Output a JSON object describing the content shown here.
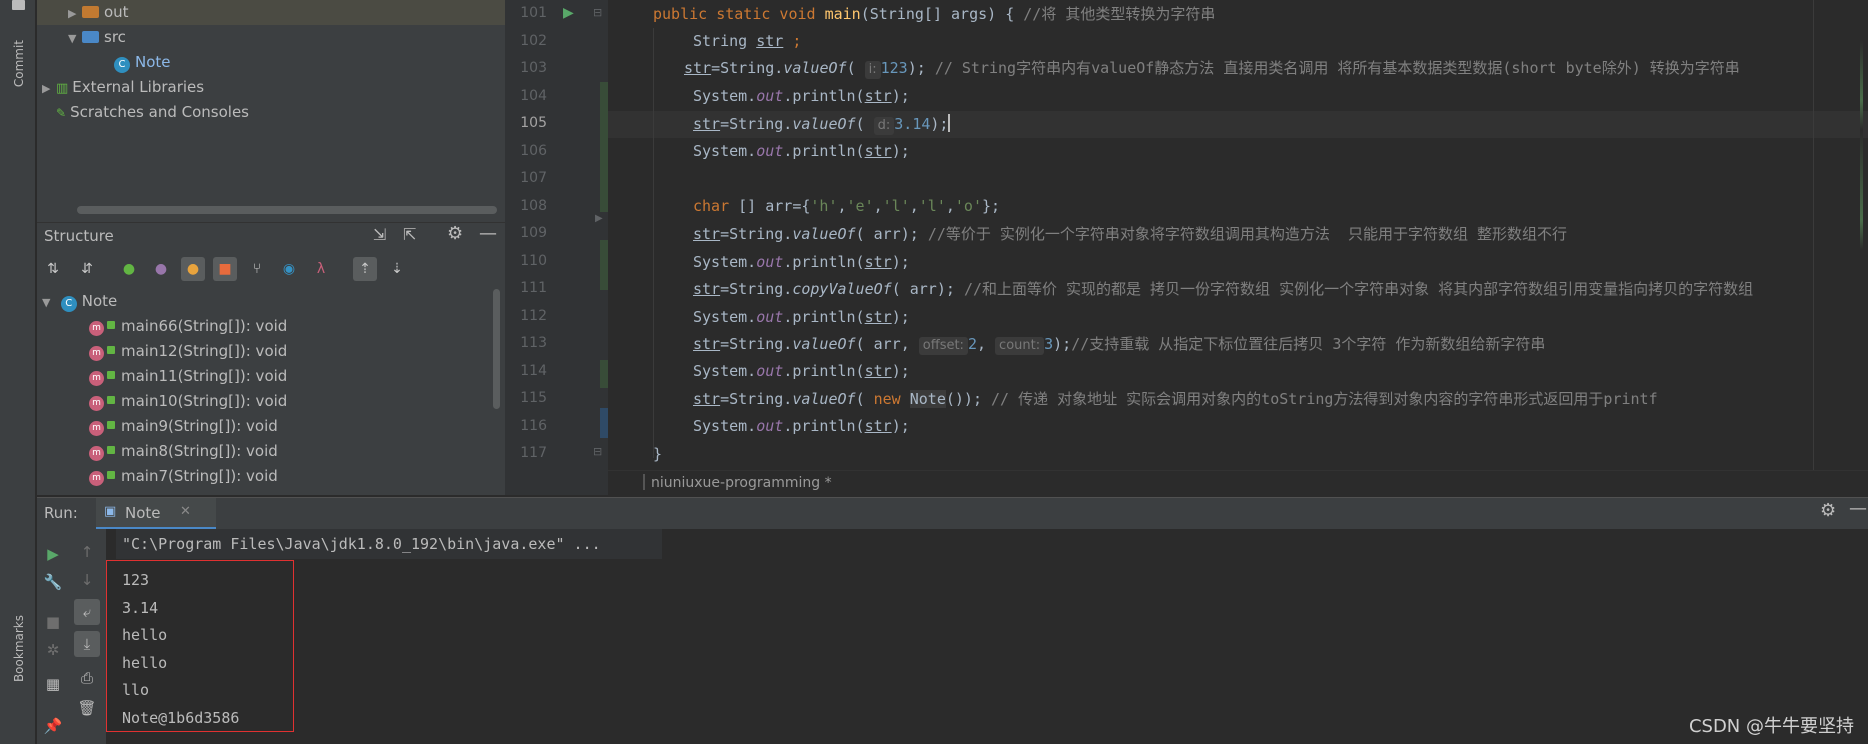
{
  "side_stripe": {
    "commit": "Commit",
    "bookmarks": "Bookmarks"
  },
  "project_tree": [
    {
      "label": "out",
      "type": "folder",
      "color": "#c27a31"
    },
    {
      "label": "src",
      "type": "folder",
      "color": "#4a88c7"
    },
    {
      "label": "Note",
      "type": "class"
    },
    {
      "label": "External Libraries",
      "type": "libraries"
    },
    {
      "label": "Scratches and Consoles",
      "type": "scratches"
    }
  ],
  "structure": {
    "title": "Structure",
    "root": "Note",
    "members": [
      "main66(String[]): void",
      "main12(String[]): void",
      "main11(String[]): void",
      "main10(String[]): void",
      "main9(String[]): void",
      "main8(String[]): void",
      "main7(String[]): void"
    ]
  },
  "editor": {
    "line_numbers": [
      "101",
      "102",
      "103",
      "104",
      "105",
      "106",
      "107",
      "108",
      "109",
      "110",
      "111",
      "112",
      "113",
      "114",
      "115",
      "116",
      "117"
    ],
    "current_line": "105",
    "breadcrumb": "niuniuxue-programming *",
    "hints": {
      "i": "i:",
      "d": "d:",
      "offset": "offset:",
      "count": "count:"
    },
    "code": {
      "l101_a": "public static void ",
      "l101_fn": "main",
      "l101_b": "(String[] args) { ",
      "l101_c": "//将 其他类型转换为字符串",
      "l102_a": "String ",
      "l102_var": "str",
      "l102_b": " ;",
      "l103_a": "=String.",
      "l103_fn": "valueOf",
      "l103_b": "( ",
      "l103_num": "123",
      "l103_c": "); ",
      "l103_cm": "// String字符串内有valueOf静态方法 直接用类名调用 将所有基本数据类型数据(short byte除外) 转换为字符串",
      "println_a": "System.",
      "println_out": "out",
      "println_b": ".println(",
      "println_c": ");",
      "l105_num": "3.14",
      "l108_kw": "char",
      "l108_a": " [] arr={",
      "l108_h": "'h'",
      "l108_e": "'e'",
      "l108_l": "'l'",
      "l108_o": "'o'",
      "l108_b": "};",
      "comma": ",",
      "arr": "arr",
      "l109_cm": "//等价于 实例化一个字符串对象将字符数组调用其构造方法  只能用于字符数组 整形数组不行",
      "copy_fn": "copyValueOf",
      "l111_cm": "//和上面等价 实现的都是 拷贝一份字符数组 实例化一个字符串对象 将其内部字符数组引用变量指向拷贝的字符数组",
      "l113_num1": "2",
      "l113_num2": "3",
      "l113_cm": "//支持重载 从指定下标位置往后拷贝 3个字符 作为新数组给新字符串",
      "l115_kw": "new",
      "l115_cls": "Note",
      "l115_b": "()); ",
      "l115_cm": "// 传递 对象地址 实际会调用对象内的toString方法得到对象内容的字符串形式返回用于printf",
      "l117": "}"
    }
  },
  "run": {
    "label": "Run:",
    "tab": "Note",
    "command": "\"C:\\Program Files\\Java\\jdk1.8.0_192\\bin\\java.exe\" ...",
    "output": [
      "123",
      "3.14",
      "hello",
      "hello",
      "llo",
      "Note@1b6d3586"
    ]
  },
  "watermark": "CSDN @牛牛要坚持"
}
